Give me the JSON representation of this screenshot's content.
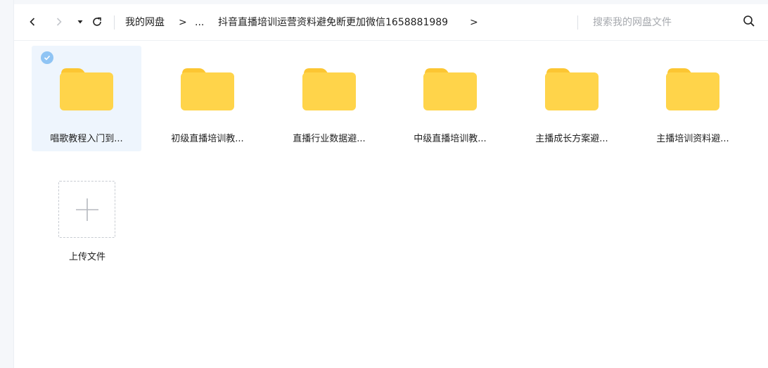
{
  "breadcrumb": {
    "root": "我的网盘",
    "sep": ">",
    "ellipsis": "...",
    "current": "抖音直播培训运营资料避免断更加微信1658881989"
  },
  "search": {
    "placeholder": "搜索我的网盘文件"
  },
  "icons": {
    "back": "chevron-left-icon",
    "forward": "chevron-right-icon",
    "dropdown": "caret-down-icon",
    "refresh": "refresh-icon",
    "search": "search-icon",
    "folder": "folder-icon",
    "check": "check-circle-icon",
    "plus": "plus-icon"
  },
  "colors": {
    "folder": "#ffd44a",
    "folder_tab": "#fcc632",
    "selected_bg": "#eef5fd",
    "check": "#8fc4f4"
  },
  "files": [
    {
      "name": "唱歌教程入门到...",
      "selected": true
    },
    {
      "name": "初级直播培训教...",
      "selected": false
    },
    {
      "name": "直播行业数据避...",
      "selected": false
    },
    {
      "name": "中级直播培训教...",
      "selected": false
    },
    {
      "name": "主播成长方案避...",
      "selected": false
    },
    {
      "name": "主播培训资料避...",
      "selected": false
    }
  ],
  "upload": {
    "label": "上传文件"
  }
}
